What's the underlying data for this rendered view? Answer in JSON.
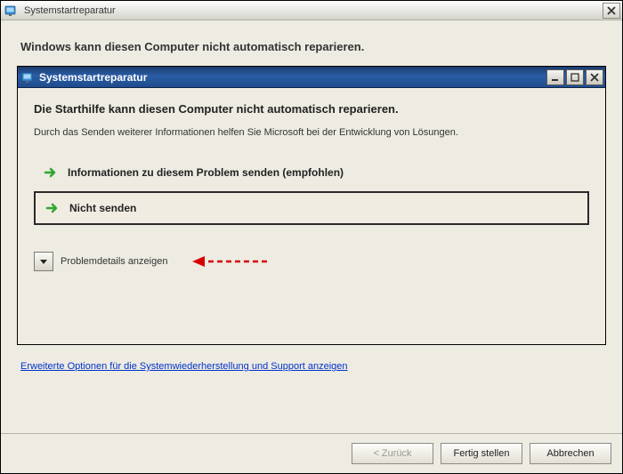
{
  "outer": {
    "title": "Systemstartreparatur",
    "heading": "Windows kann diesen Computer nicht automatisch reparieren."
  },
  "inner": {
    "title": "Systemstartreparatur",
    "heading": "Die Starthilfe kann diesen Computer nicht automatisch reparieren.",
    "text": "Durch das Senden weiterer Informationen helfen Sie Microsoft bei der Entwicklung von Lösungen.",
    "option_send": "Informationen zu diesem Problem senden (empfohlen)",
    "option_nosend": "Nicht senden",
    "details_label": "Problemdetails anzeigen"
  },
  "link": {
    "advanced": "Erweiterte Optionen für die Systemwiederherstellung und Support anzeigen"
  },
  "footer": {
    "back": "< Zurück",
    "finish": "Fertig stellen",
    "cancel": "Abbrechen"
  }
}
